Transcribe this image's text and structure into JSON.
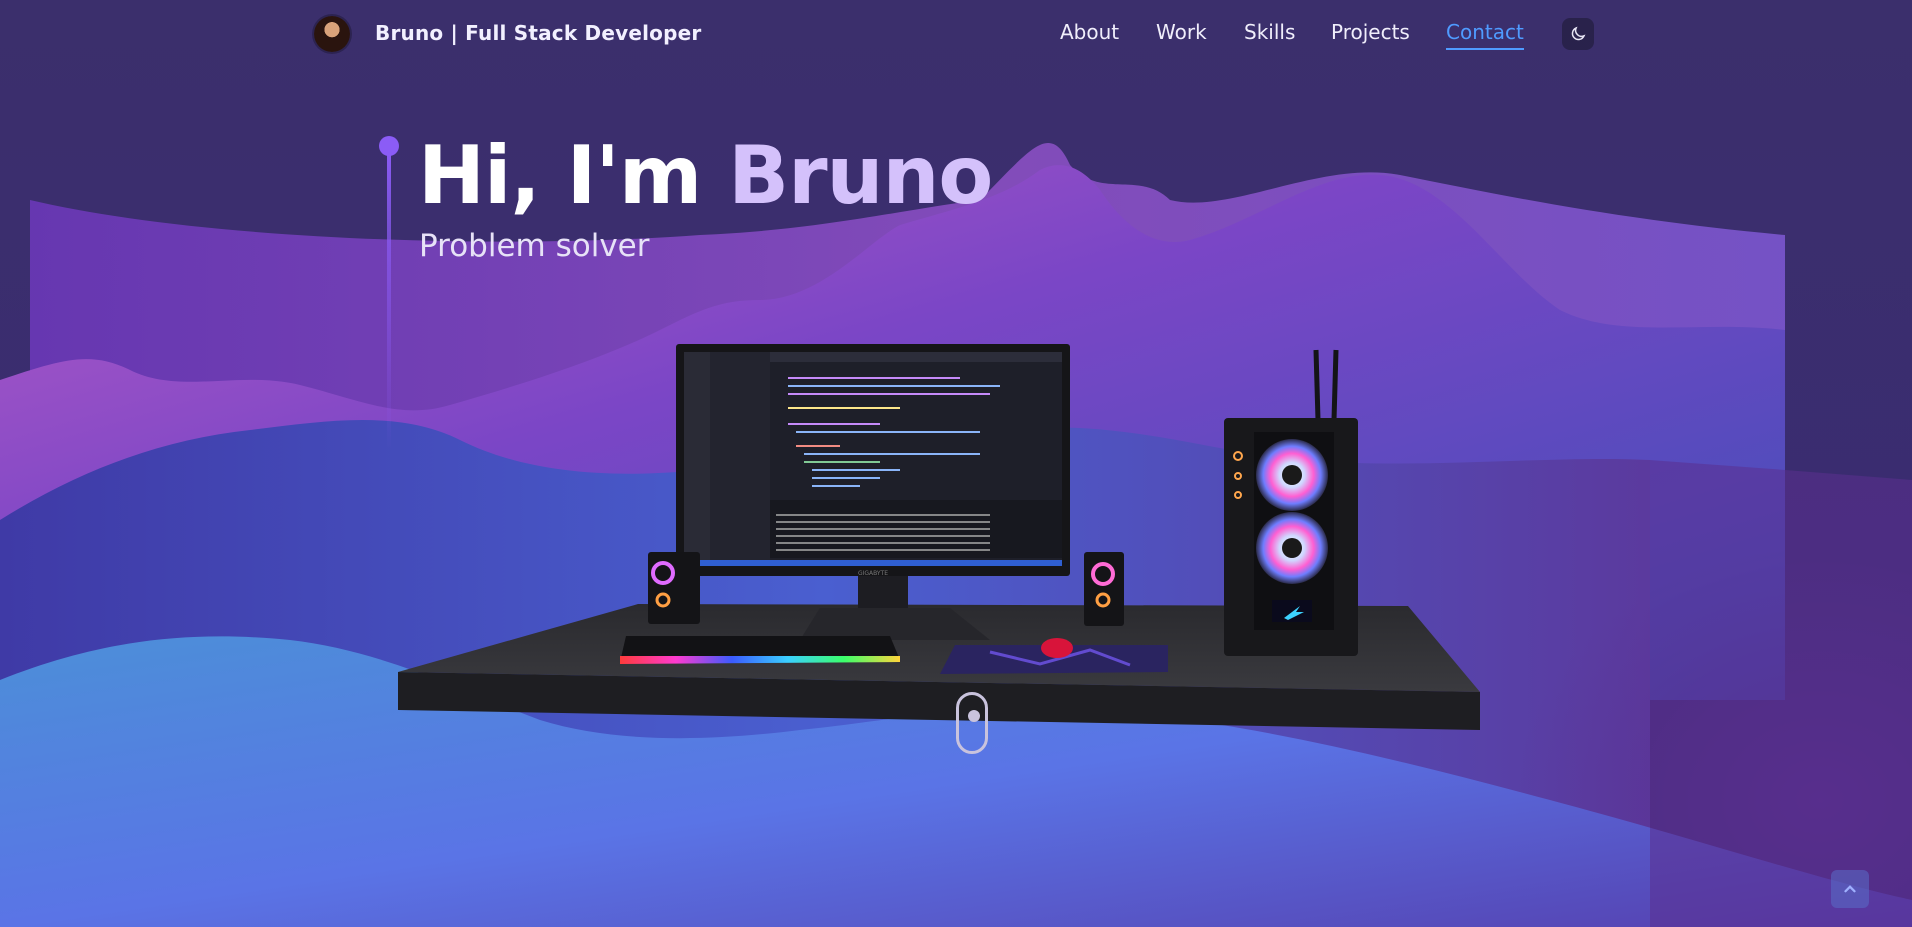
{
  "header": {
    "brand": "Bruno  | Full Stack Developer",
    "avatar_icon": "profile-avatar",
    "nav": [
      {
        "label": "About"
      },
      {
        "label": "Work"
      },
      {
        "label": "Skills"
      },
      {
        "label": "Projects"
      },
      {
        "label": "Contact",
        "active": true
      }
    ],
    "theme_toggle_icon": "moon-icon"
  },
  "hero": {
    "greeting": "Hi, I'm ",
    "name": "Bruno",
    "subtitle": "Problem solver"
  },
  "scene": {
    "description_icon": "desk-setup-3d",
    "monitor_brand": "GIGABYTE"
  },
  "scroll_indicator_icon": "mouse-scroll-icon",
  "back_to_top_icon": "chevron-up-icon",
  "colors": {
    "accent": "#4f9bff",
    "name_highlight": "#d4c1fb",
    "timeline": "#8b5cf6",
    "background": "#3a2c6d"
  }
}
